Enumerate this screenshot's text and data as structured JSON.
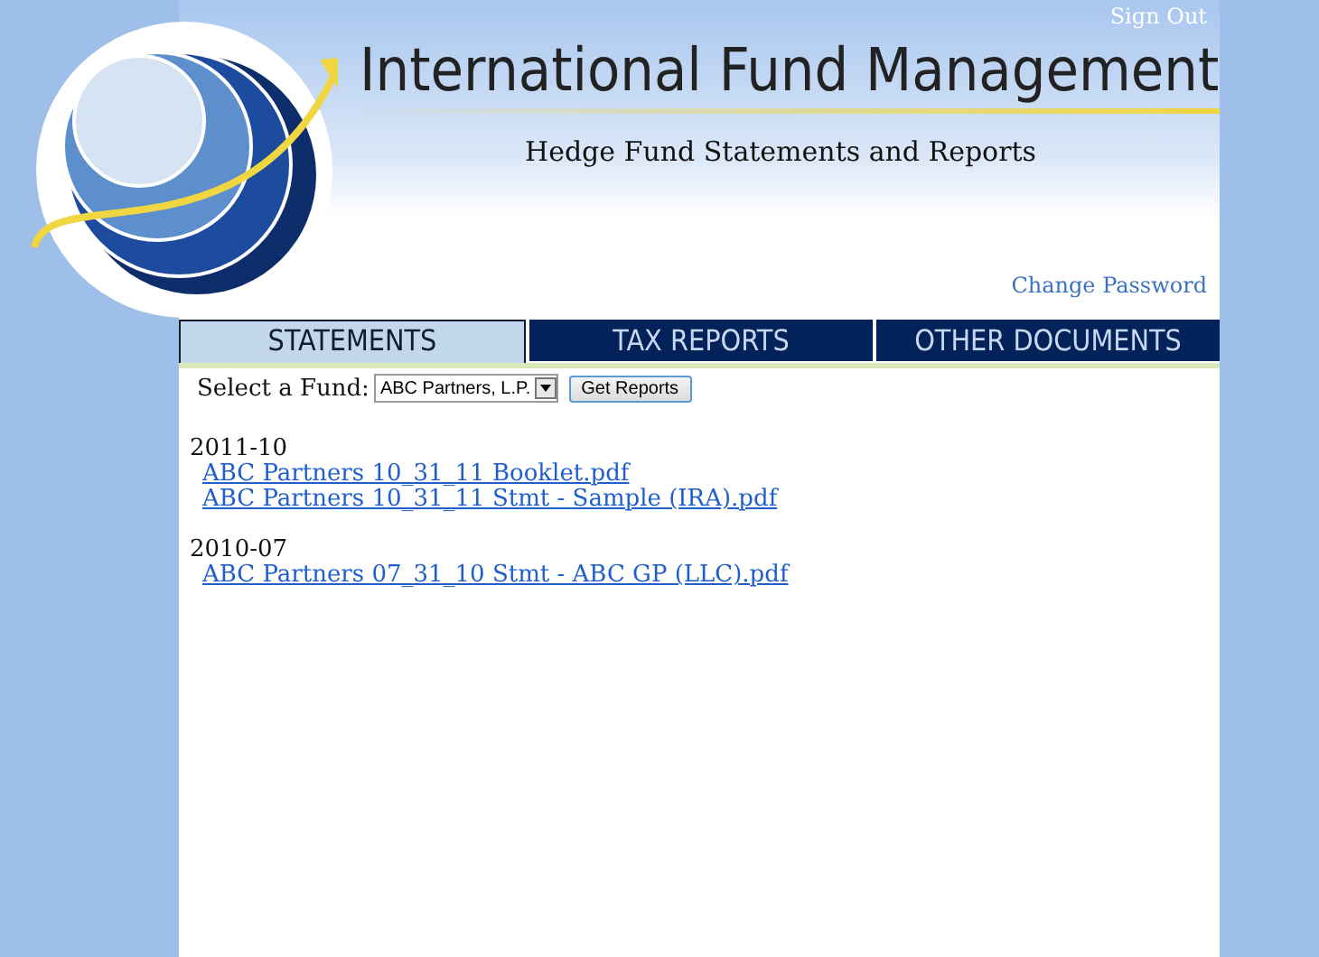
{
  "header": {
    "sign_out": "Sign Out",
    "title": "International Fund Management",
    "subtitle": "Hedge Fund Statements and Reports",
    "change_password": "Change Password"
  },
  "tabs": [
    {
      "label": "STATEMENTS",
      "selected": true
    },
    {
      "label": "TAX REPORTS",
      "selected": false
    },
    {
      "label": "OTHER DOCUMENTS",
      "selected": false
    }
  ],
  "fund_select": {
    "label": "Select a Fund:",
    "value": "ABC Partners, L.P.",
    "button": "Get Reports"
  },
  "groups": [
    {
      "period": "2011-10",
      "files": [
        "ABC Partners 10_31_11 Booklet.pdf",
        "ABC Partners 10_31_11 Stmt - Sample (IRA).pdf"
      ]
    },
    {
      "period": "2010-07",
      "files": [
        "ABC Partners 07_31_10 Stmt - ABC GP (LLC).pdf"
      ]
    }
  ]
}
